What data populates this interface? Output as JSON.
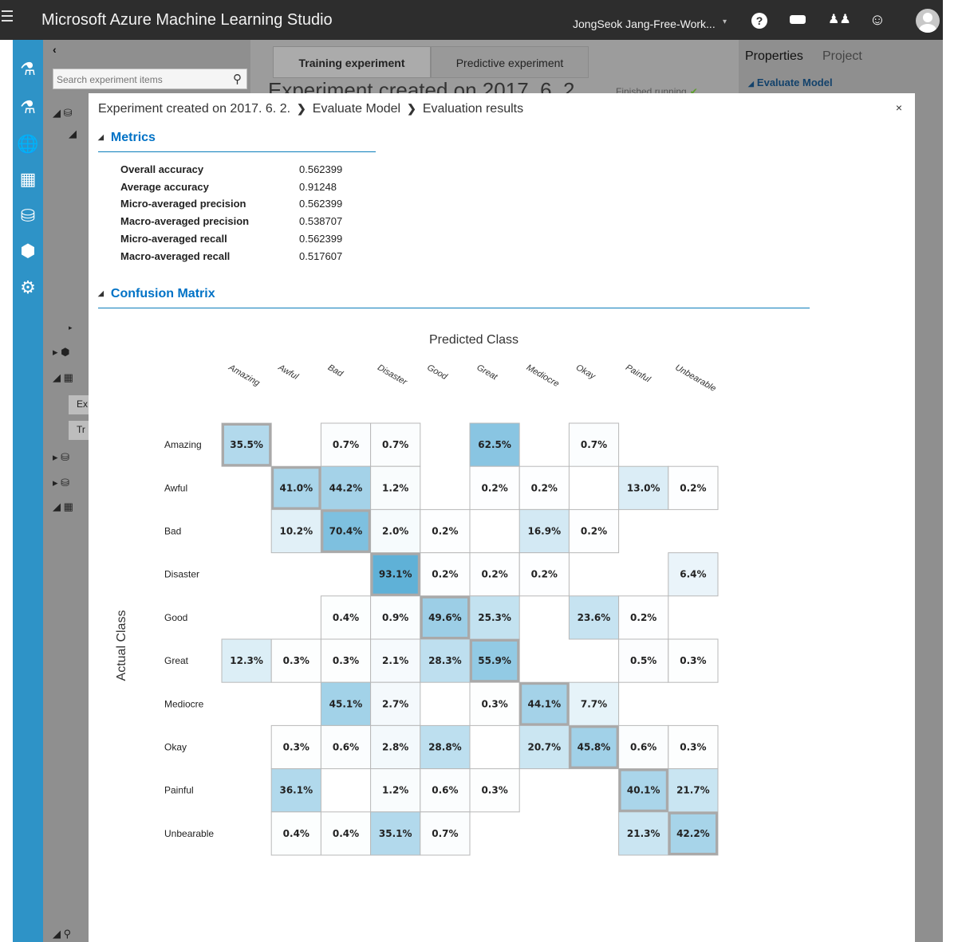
{
  "topbar": {
    "app_title": "Microsoft Azure Machine Learning Studio",
    "workspace": "JongSeok Jang-Free-Work...",
    "help_glyph": "?",
    "icons": [
      "hamburger-icon",
      "help-icon",
      "chat-icon",
      "people-icon",
      "smile-icon",
      "avatar"
    ]
  },
  "rail": {
    "icons": [
      "projects-icon",
      "experiments-icon",
      "web-services-icon",
      "notebooks-icon",
      "datasets-icon",
      "trained-models-icon",
      "settings-icon"
    ]
  },
  "palette": {
    "collapse_glyph": "‹",
    "search_placeholder": "Search experiment items",
    "tree_box_1": "Ex",
    "tree_box_2": "Tr"
  },
  "canvas": {
    "tabs": [
      "Training experiment",
      "Predictive experiment"
    ],
    "title": "Experiment created on 2017. 6. 2.",
    "status": "Finished running"
  },
  "properties": {
    "tabs": [
      "Properties",
      "Project"
    ],
    "module": "Evaluate Model"
  },
  "modal": {
    "close_glyph": "×",
    "breadcrumb": [
      "Experiment created on 2017. 6. 2.",
      "Evaluate Model",
      "Evaluation results"
    ],
    "metrics_title": "Metrics",
    "metrics": [
      {
        "name": "Overall accuracy",
        "value": "0.562399"
      },
      {
        "name": "Average accuracy",
        "value": "0.91248"
      },
      {
        "name": "Micro-averaged precision",
        "value": "0.562399"
      },
      {
        "name": "Macro-averaged precision",
        "value": "0.538707"
      },
      {
        "name": "Micro-averaged recall",
        "value": "0.562399"
      },
      {
        "name": "Macro-averaged recall",
        "value": "0.517607"
      }
    ],
    "confusion_title": "Confusion Matrix"
  },
  "chart_data": {
    "type": "heatmap",
    "title": "Predicted Class",
    "xlabel": "Predicted Class",
    "ylabel": "Actual Class",
    "classes": [
      "Amazing",
      "Awful",
      "Bad",
      "Disaster",
      "Good",
      "Great",
      "Mediocre",
      "Okay",
      "Painful",
      "Unbearable"
    ],
    "values": [
      [
        "35.5%",
        "",
        "0.7%",
        "0.7%",
        "",
        "62.5%",
        "",
        "0.7%",
        "",
        ""
      ],
      [
        "",
        "41.0%",
        "44.2%",
        "1.2%",
        "",
        "0.2%",
        "0.2%",
        "",
        "13.0%",
        "0.2%"
      ],
      [
        "",
        "10.2%",
        "70.4%",
        "2.0%",
        "0.2%",
        "",
        "16.9%",
        "0.2%",
        "",
        ""
      ],
      [
        "",
        "",
        "",
        "93.1%",
        "0.2%",
        "0.2%",
        "0.2%",
        "",
        "",
        "6.4%"
      ],
      [
        "",
        "",
        "0.4%",
        "0.9%",
        "49.6%",
        "25.3%",
        "",
        "23.6%",
        "0.2%",
        ""
      ],
      [
        "12.3%",
        "0.3%",
        "0.3%",
        "2.1%",
        "28.3%",
        "55.9%",
        "",
        "",
        "0.5%",
        "0.3%"
      ],
      [
        "",
        "",
        "45.1%",
        "2.7%",
        "",
        "0.3%",
        "44.1%",
        "7.7%",
        "",
        ""
      ],
      [
        "",
        "0.3%",
        "0.6%",
        "2.8%",
        "28.8%",
        "",
        "20.7%",
        "45.8%",
        "0.6%",
        "0.3%"
      ],
      [
        "",
        "36.1%",
        "",
        "1.2%",
        "0.6%",
        "0.3%",
        "",
        "",
        "40.1%",
        "21.7%"
      ],
      [
        "",
        "0.4%",
        "0.4%",
        "35.1%",
        "0.7%",
        "",
        "",
        "",
        "21.3%",
        "42.2%"
      ]
    ],
    "color_low": "#ffffff",
    "color_high": "#5aaed6",
    "diagonal_border": "#a9a9a9",
    "legend": "none"
  }
}
